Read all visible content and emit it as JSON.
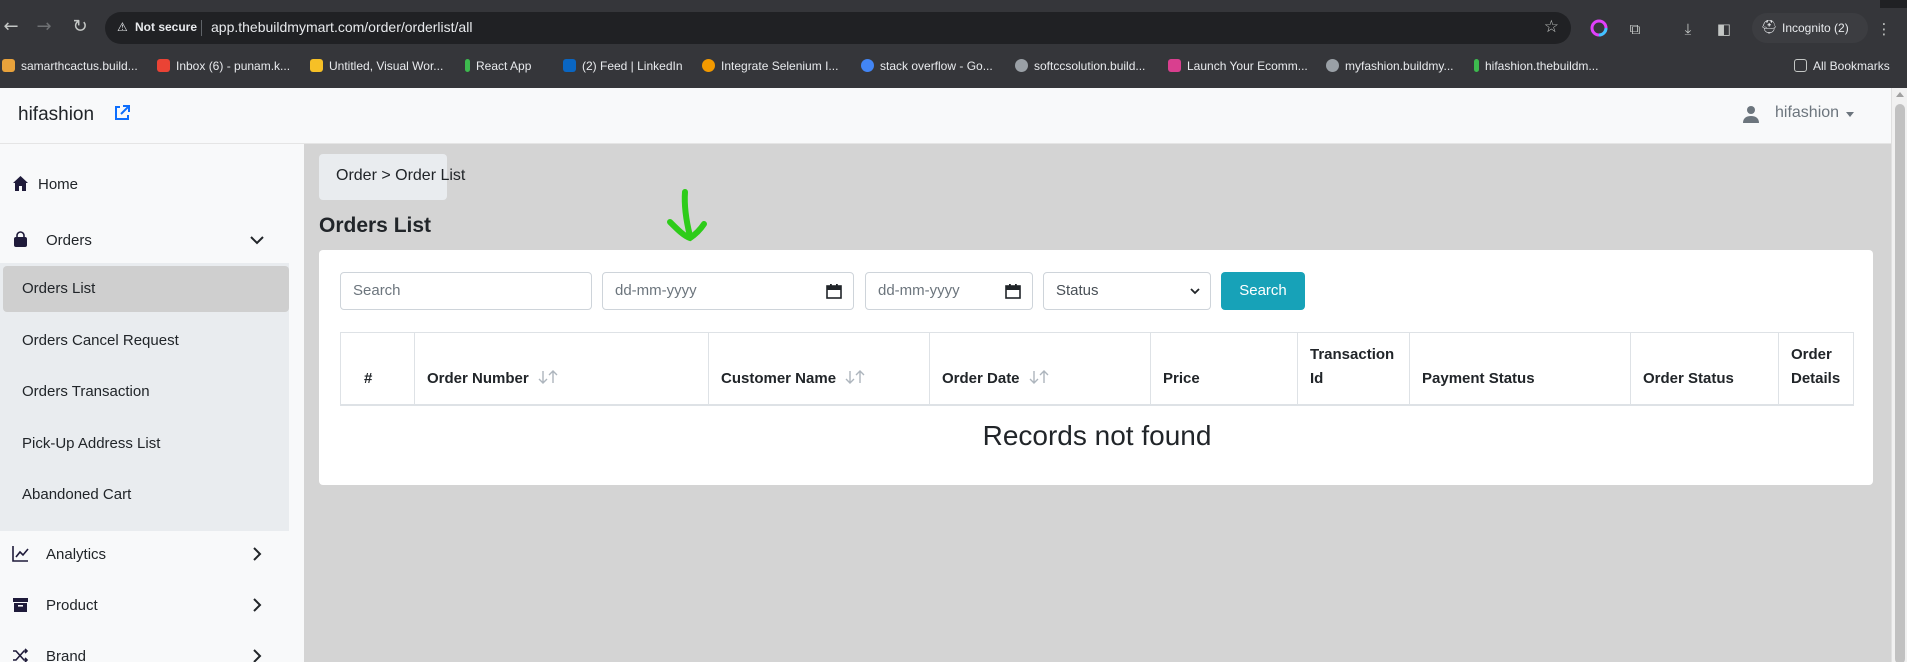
{
  "browser": {
    "security_label": "Not secure",
    "url": "app.thebuildmymart.com/order/orderlist/all",
    "incognito_label": "Incognito (2)",
    "all_bookmarks_label": "All Bookmarks",
    "bookmarks": [
      {
        "label": "samarthcactus.build...",
        "color": "#e8a23b"
      },
      {
        "label": "Inbox (6) - punam.k...",
        "color": "#ea4335"
      },
      {
        "label": "Untitled, Visual Wor...",
        "color": "#f6c026"
      },
      {
        "label": "React App",
        "color": "#3dba4e"
      },
      {
        "label": "(2) Feed | LinkedIn",
        "color": "#0a66c2"
      },
      {
        "label": "Integrate Selenium I...",
        "color": "#f29900"
      },
      {
        "label": "stack overflow - Go...",
        "color": "#4285f4"
      },
      {
        "label": "softccsolution.build...",
        "color": "#9aa0a6"
      },
      {
        "label": "Launch Your Ecomm...",
        "color": "#d93f8f"
      },
      {
        "label": "myfashion.buildmy...",
        "color": "#9aa0a6"
      },
      {
        "label": "hifashion.thebuildm...",
        "color": "#3dba4e"
      }
    ]
  },
  "header": {
    "brand": "hifashion",
    "user_name": "hifashion"
  },
  "sidebar": {
    "items": [
      {
        "label": "Home",
        "icon": "home-icon"
      },
      {
        "label": "Orders",
        "icon": "shopping-bag-icon"
      },
      {
        "label": "Analytics",
        "icon": "chart-line-icon"
      },
      {
        "label": "Product",
        "icon": "archive-box-icon"
      },
      {
        "label": "Brand",
        "icon": "shuffle-icon"
      }
    ],
    "orders_sub": [
      {
        "label": "Orders List",
        "active": true
      },
      {
        "label": "Orders Cancel Request"
      },
      {
        "label": "Orders Transaction"
      },
      {
        "label": "Pick-Up Address List"
      },
      {
        "label": "Abandoned Cart"
      }
    ]
  },
  "main": {
    "breadcrumb": "Order > Order List",
    "title": "Orders List",
    "filters": {
      "search_placeholder": "Search",
      "date_from_placeholder": "dd-mm-yyyy",
      "date_to_placeholder": "dd-mm-yyyy",
      "status_label": "Status",
      "search_button": "Search"
    },
    "table": {
      "columns": [
        "#",
        "Order Number",
        "Customer Name",
        "Order Date",
        "Price",
        "Transaction Id",
        "Payment Status",
        "Order Status",
        "Order Details"
      ],
      "empty_message": "Records not found"
    }
  },
  "colors": {
    "accent": "#17a2b8",
    "annotation": "#2ecc1a"
  }
}
